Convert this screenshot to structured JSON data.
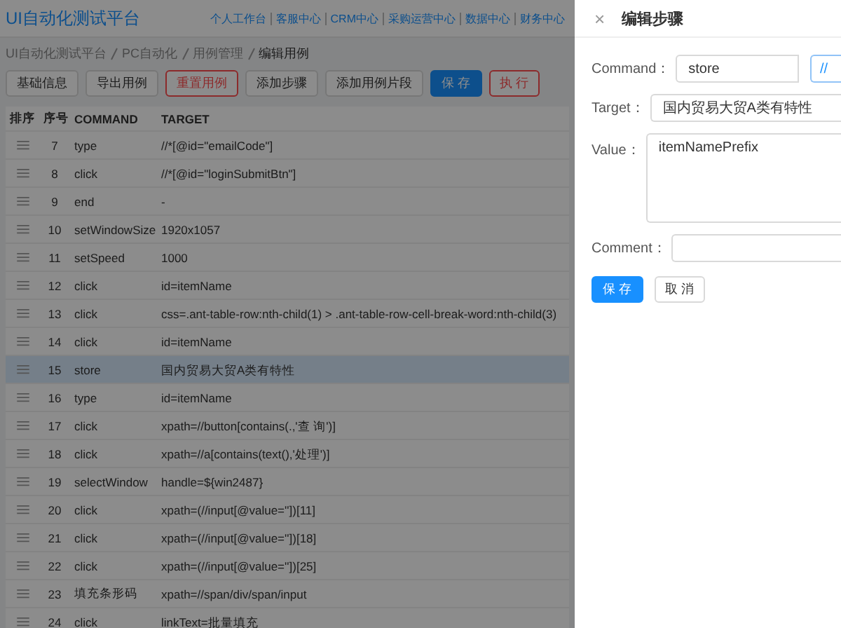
{
  "header": {
    "title": "UI自动化测试平台",
    "nav": [
      "个人工作台",
      "客服中心",
      "CRM中心",
      "采购运营中心",
      "数据中心",
      "财务中心"
    ]
  },
  "breadcrumb": [
    "UI自动化测试平台",
    "PC自动化",
    "用例管理",
    "编辑用例"
  ],
  "toolbar": [
    {
      "label": "基础信息",
      "kind": "default"
    },
    {
      "label": "导出用例",
      "kind": "default"
    },
    {
      "label": "重置用例",
      "kind": "danger"
    },
    {
      "label": "添加步骤",
      "kind": "default"
    },
    {
      "label": "添加用例片段",
      "kind": "default"
    },
    {
      "label": "保 存",
      "kind": "primary"
    },
    {
      "label": "执 行",
      "kind": "danger"
    }
  ],
  "table": {
    "columns": [
      "排序",
      "序号",
      "COMMAND",
      "TARGET"
    ],
    "rows": [
      {
        "seq": "7",
        "command": "type",
        "target": "//*[@id=\"emailCode\"]",
        "selected": false
      },
      {
        "seq": "8",
        "command": "click",
        "target": "//*[@id=\"loginSubmitBtn\"]",
        "selected": false
      },
      {
        "seq": "9",
        "command": "end",
        "target": "-",
        "selected": false
      },
      {
        "seq": "10",
        "command": "setWindowSize",
        "target": "1920x1057",
        "selected": false
      },
      {
        "seq": "11",
        "command": "setSpeed",
        "target": "1000",
        "selected": false
      },
      {
        "seq": "12",
        "command": "click",
        "target": "id=itemName",
        "selected": false
      },
      {
        "seq": "13",
        "command": "click",
        "target": "css=.ant-table-row:nth-child(1) > .ant-table-row-cell-break-word:nth-child(3)",
        "selected": false
      },
      {
        "seq": "14",
        "command": "click",
        "target": "id=itemName",
        "selected": false
      },
      {
        "seq": "15",
        "command": "store",
        "target": "国内贸易大贸A类有特性",
        "selected": true
      },
      {
        "seq": "16",
        "command": "type",
        "target": "id=itemName",
        "selected": false
      },
      {
        "seq": "17",
        "command": "click",
        "target": "xpath=//button[contains(.,'查 询')]",
        "selected": false
      },
      {
        "seq": "18",
        "command": "click",
        "target": "xpath=//a[contains(text(),'处理')]",
        "selected": false
      },
      {
        "seq": "19",
        "command": "selectWindow",
        "target": "handle=${win2487}",
        "selected": false
      },
      {
        "seq": "20",
        "command": "click",
        "target": "xpath=(//input[@value=''])[11]",
        "selected": false
      },
      {
        "seq": "21",
        "command": "click",
        "target": "xpath=(//input[@value=''])[18]",
        "selected": false
      },
      {
        "seq": "22",
        "command": "click",
        "target": "xpath=(//input[@value=''])[25]",
        "selected": false
      },
      {
        "seq": "23",
        "command": "填充条形码",
        "target": "xpath=//span/div/span/input",
        "selected": false
      },
      {
        "seq": "24",
        "command": "click",
        "target": "linkText=批量填充",
        "selected": false
      }
    ]
  },
  "drawer": {
    "title": "编辑步骤",
    "close": "×",
    "command": {
      "label": "Command：",
      "value": "store",
      "side_button": "//"
    },
    "target": {
      "label": "Target：",
      "value": "国内贸易大贸A类有特性"
    },
    "value": {
      "label": "Value：",
      "value": "itemNamePrefix"
    },
    "comment": {
      "label": "Comment："
    },
    "buttons": [
      {
        "label": "保 存",
        "kind": "primary"
      },
      {
        "label": "取 消",
        "kind": "default"
      }
    ]
  }
}
